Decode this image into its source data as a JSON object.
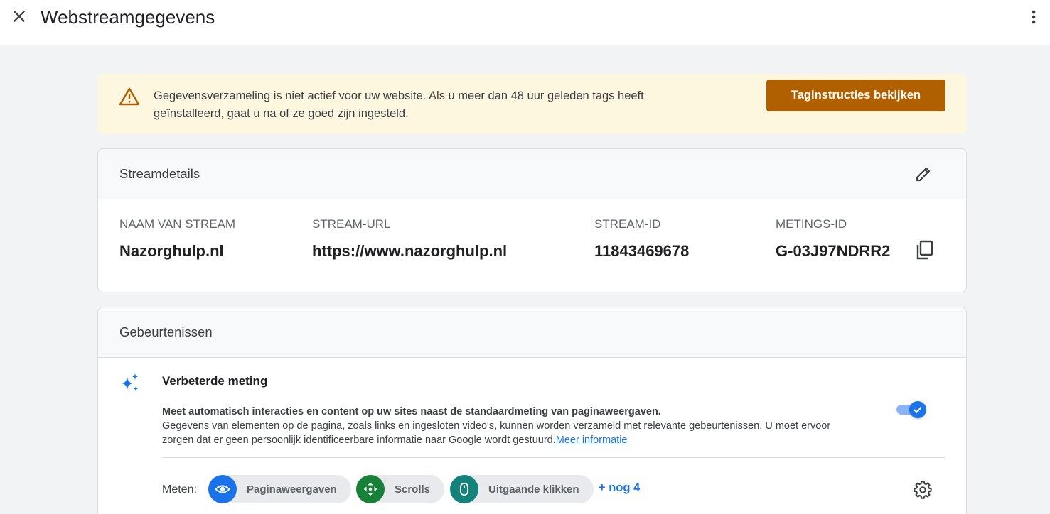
{
  "header": {
    "title": "Webstreamgegevens",
    "close_icon": "close-icon",
    "more_icon": "more-vert-icon"
  },
  "banner": {
    "icon": "warning-icon",
    "text_line1": "Gegevensverzameling is niet actief voor uw website. Als u meer dan 48 uur geleden tags heeft",
    "text_line2": "geïnstalleerd, gaat u na of ze goed zijn ingesteld.",
    "button_label": "Taginstructies bekijken",
    "button_color": "#b06000",
    "background_color": "#fef7e0"
  },
  "stream_details": {
    "title": "Streamdetails",
    "edit_icon": "pencil-icon",
    "fields": [
      {
        "label": "NAAM VAN STREAM",
        "value": "Nazorghulp.nl"
      },
      {
        "label": "STREAM-URL",
        "value": "https://www.nazorghulp.nl"
      },
      {
        "label": "STREAM-ID",
        "value": "11843469678"
      },
      {
        "label": "METINGS-ID",
        "value": "G-03J97NDRR2"
      }
    ],
    "copy_icon": "copy-icon"
  },
  "events": {
    "title": "Gebeurtenissen",
    "enhanced": {
      "icon": "sparkle-icon",
      "title": "Verbeterde meting",
      "desc_bold": "Meet automatisch interacties en content op uw sites naast de standaardmeting van paginaweergaven.",
      "desc_line2": "Gegevens van elementen op de pagina, zoals links en ingesloten video's, kunnen worden verzameld met relevante gebeurtenissen. U moet ervoor",
      "desc_line3": "zorgen dat er geen persoonlijk identificeerbare informatie naar Google wordt gestuurd.",
      "link": "Meer informatie",
      "toggle_on": true
    },
    "measure_label": "Meten:",
    "chips": [
      {
        "label": "Paginaweergaven",
        "icon": "eye-icon",
        "color": "#1a73e8"
      },
      {
        "label": "Scrolls",
        "icon": "scroll-arrows-icon",
        "color": "#188038"
      },
      {
        "label": "Uitgaande klikken",
        "icon": "mouse-icon",
        "color": "#12827a"
      }
    ],
    "more_link": "+ nog 4",
    "settings_icon": "gear-icon"
  }
}
